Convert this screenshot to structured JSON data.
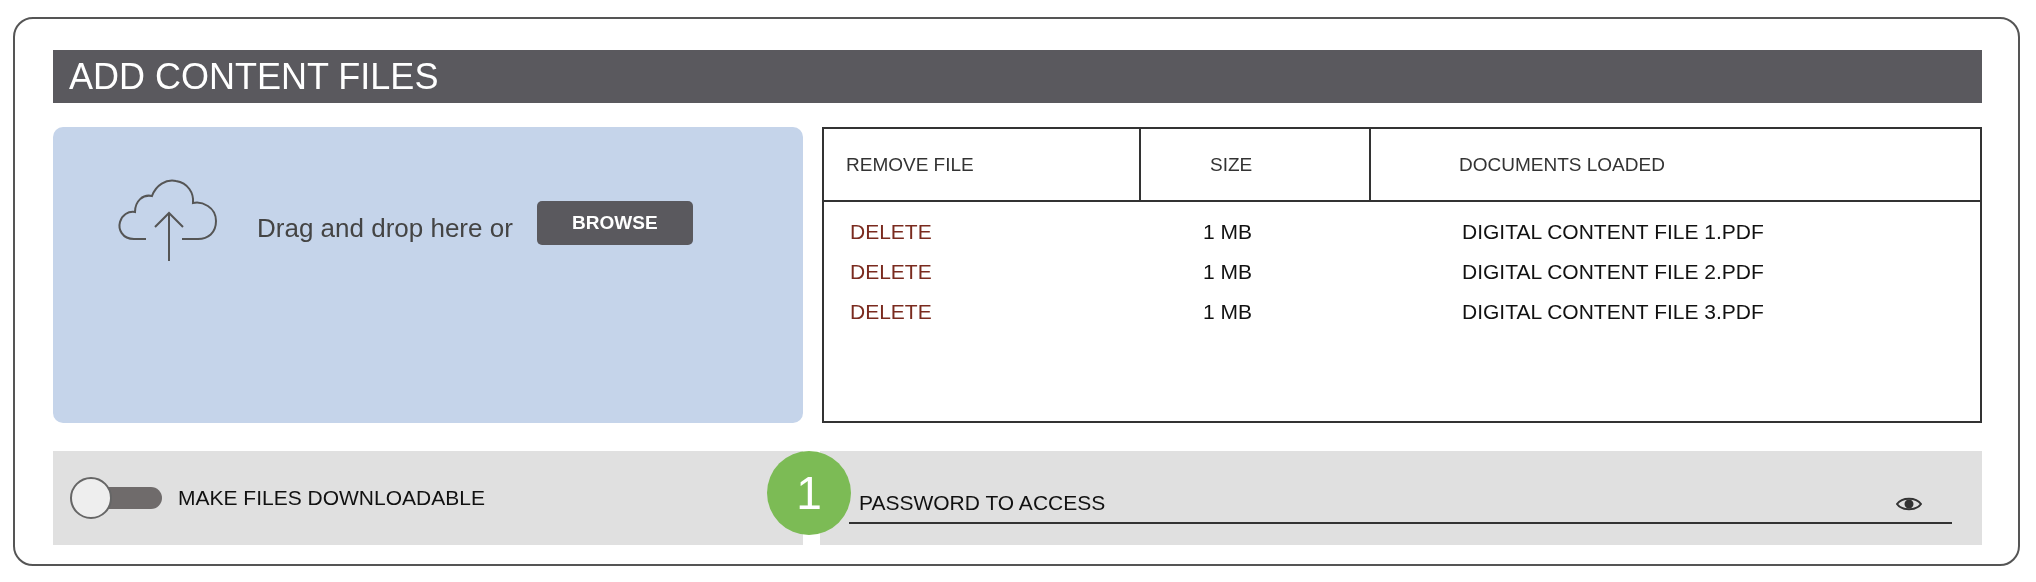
{
  "title": "ADD CONTENT FILES",
  "dropzone": {
    "prompt": "Drag and drop here or",
    "button": "BROWSE"
  },
  "table": {
    "columns": [
      "REMOVE FILE",
      "SIZE",
      "DOCUMENTS LOADED"
    ],
    "rows": [
      {
        "action": "DELETE",
        "size": "1 MB",
        "document": "DIGITAL CONTENT FILE 1.PDF"
      },
      {
        "action": "DELETE",
        "size": "1 MB",
        "document": "DIGITAL CONTENT FILE 2.PDF"
      },
      {
        "action": "DELETE",
        "size": "1 MB",
        "document": "DIGITAL CONTENT FILE 3.PDF"
      }
    ]
  },
  "download_toggle": {
    "label": "MAKE FILES DOWNLOADABLE",
    "on": false
  },
  "password": {
    "placeholder": "PASSWORD TO ACCESS"
  },
  "badge": "1"
}
